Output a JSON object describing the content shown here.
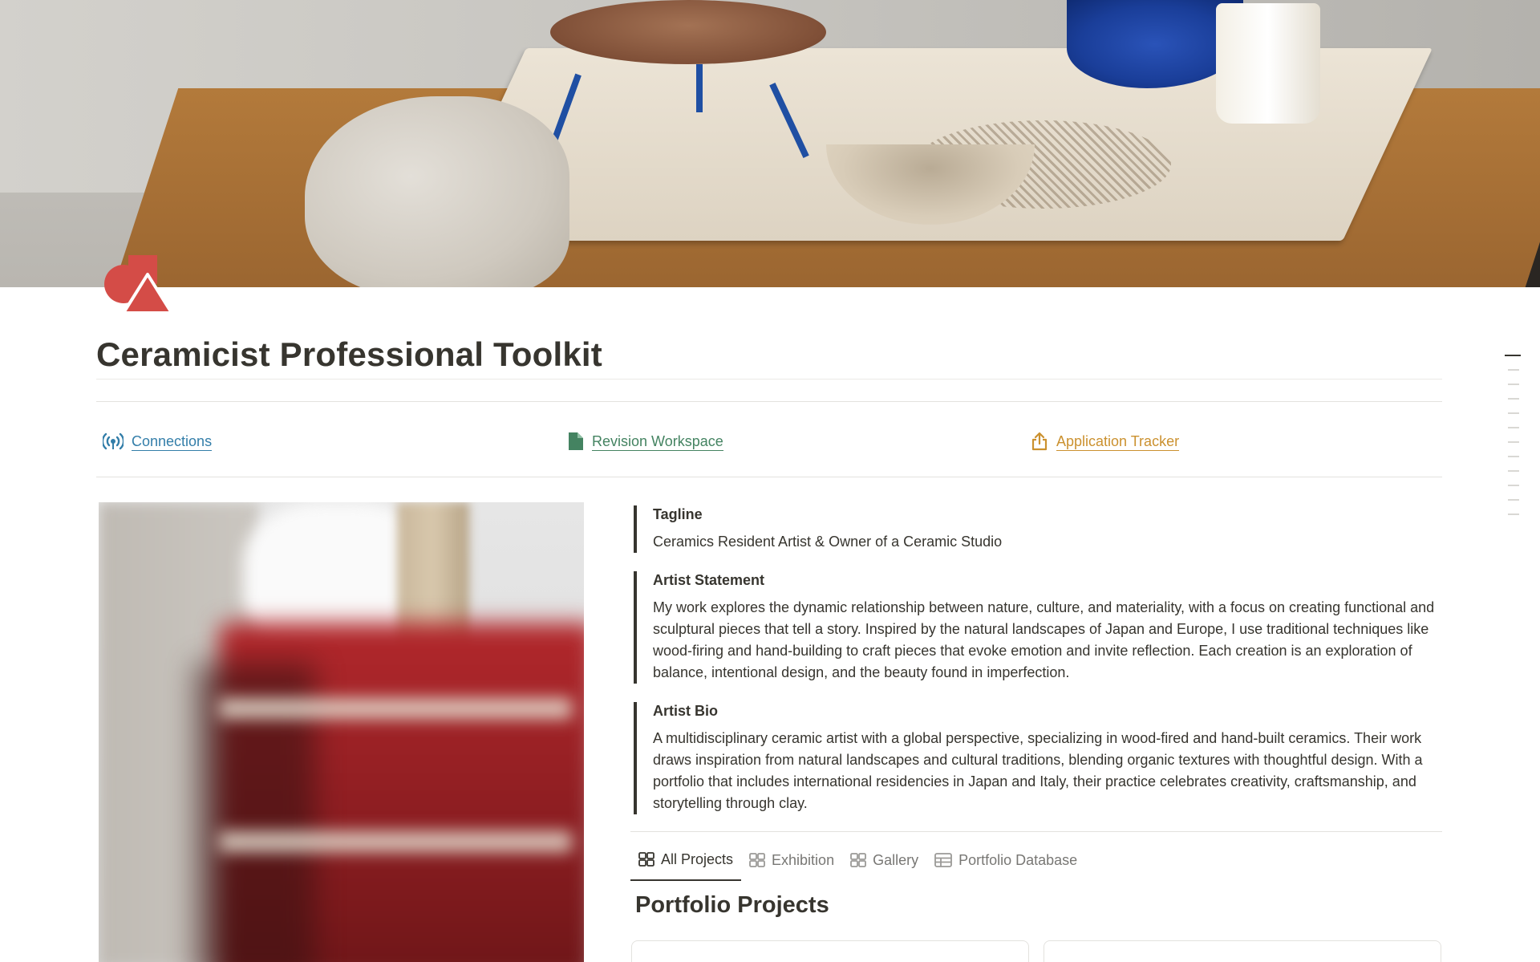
{
  "page": {
    "title": "Ceramicist Professional Toolkit",
    "icon": "shapes-icon",
    "cover": "ceramic-studio-workbench-photo"
  },
  "links": [
    {
      "label": "Connections",
      "icon": "broadcast-icon",
      "color": "#337ea9"
    },
    {
      "label": "Revision Workspace",
      "icon": "document-icon",
      "color": "#448361"
    },
    {
      "label": "Application Tracker",
      "icon": "share-upload-icon",
      "color": "#cb912f"
    }
  ],
  "callouts": {
    "tagline": {
      "heading": "Tagline",
      "text": "Ceramics Resident Artist & Owner of a Ceramic Studio"
    },
    "statement": {
      "heading": "Artist Statement",
      "text": "My work explores the dynamic relationship between nature, culture, and materiality, with a focus on creating functional and sculptural pieces that tell a story. Inspired by the natural landscapes of Japan and Europe, I use traditional techniques like wood-firing and hand-building to craft pieces that evoke emotion and invite reflection. Each creation is an exploration of balance, intentional design, and the beauty found in imperfection."
    },
    "bio": {
      "heading": "Artist Bio",
      "text": "A multidisciplinary ceramic artist with a global perspective, specializing in wood-fired and hand-built ceramics. Their work draws inspiration from natural landscapes and cultural traditions, blending organic textures with thoughtful design. With a portfolio that includes international residencies in Japan and Italy, their practice celebrates creativity, craftsmanship, and storytelling through clay."
    }
  },
  "tabs": [
    {
      "label": "All Projects",
      "icon": "gallery-grid-icon",
      "active": true
    },
    {
      "label": "Exhibition",
      "icon": "gallery-grid-icon",
      "active": false
    },
    {
      "label": "Gallery",
      "icon": "gallery-grid-icon",
      "active": false
    },
    {
      "label": "Portfolio Database",
      "icon": "table-icon",
      "active": false
    }
  ],
  "section": {
    "title": "Portfolio Projects"
  },
  "colors": {
    "text": "#37352f",
    "muted": "#787774",
    "icon_red": "#d44c47",
    "link_blue": "#337ea9",
    "link_green": "#448361",
    "link_orange": "#cb912f"
  }
}
